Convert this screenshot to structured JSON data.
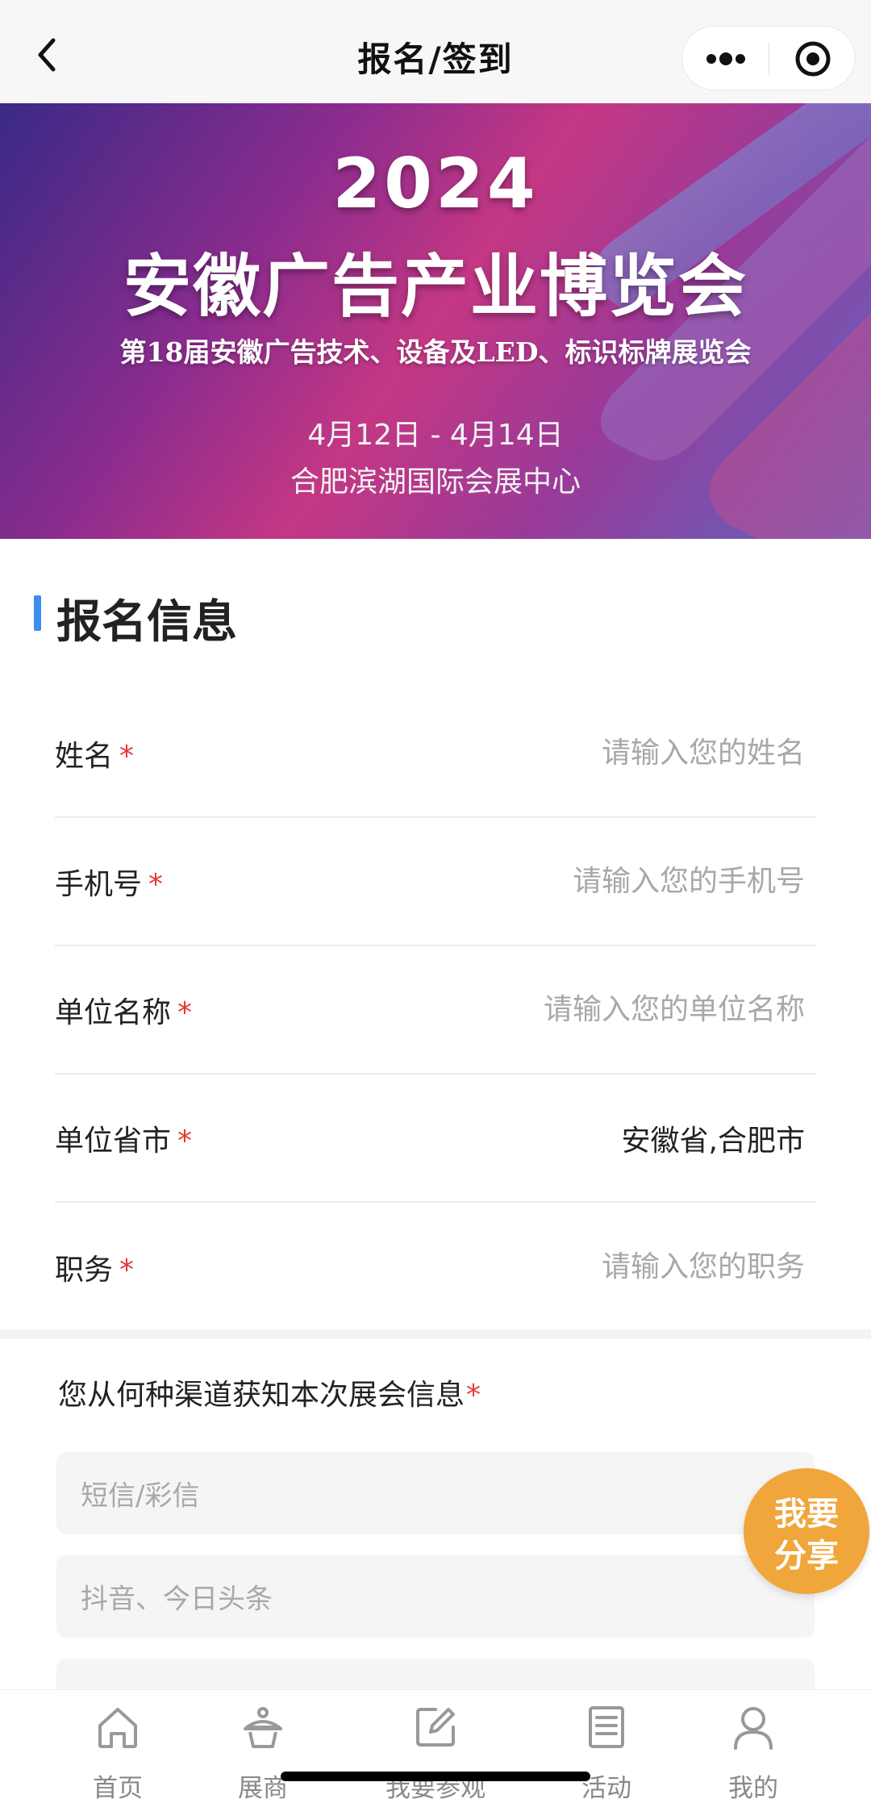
{
  "navbar": {
    "title": "报名/签到",
    "icons": {
      "back": "chevron-left-icon",
      "more": "more-dots-icon",
      "close": "target-circle-icon"
    }
  },
  "banner": {
    "year": "2024",
    "title": "安徽广告产业博览会",
    "subtitle": "第18届安徽广告技术、设备及LED、标识标牌展览会",
    "date": "4月12日 - 4月14日",
    "venue": "合肥滨湖国际会展中心"
  },
  "section": {
    "title": "报名信息",
    "accent_color": "#3d8ef0"
  },
  "form": {
    "fields": [
      {
        "label": "姓名",
        "required_mark": "*",
        "value": "",
        "placeholder": "请输入您的姓名"
      },
      {
        "label": "手机号",
        "required_mark": "*",
        "value": "",
        "placeholder": "请输入您的手机号"
      },
      {
        "label": "单位名称",
        "required_mark": "*",
        "value": "",
        "placeholder": "请输入您的单位名称"
      },
      {
        "label": "单位省市",
        "required_mark": "*",
        "value": "安徽省,合肥市",
        "placeholder": ""
      },
      {
        "label": "职务",
        "required_mark": "*",
        "value": "",
        "placeholder": "请输入您的职务"
      }
    ]
  },
  "channel_question": {
    "label": "您从何种渠道获知本次展会信息",
    "required_mark": "*",
    "options": [
      "短信/彩信",
      "抖音、今日头条"
    ]
  },
  "share_button": {
    "line1": "我要",
    "line2": "分享",
    "color": "#f0a63a"
  },
  "tabbar": {
    "items": [
      {
        "label": "首页",
        "icon": "home-icon"
      },
      {
        "label": "展商",
        "icon": "exhibitor-icon"
      },
      {
        "label": "我要参观",
        "icon": "edit-icon"
      },
      {
        "label": "活动",
        "icon": "document-icon"
      },
      {
        "label": "我的",
        "icon": "user-icon"
      }
    ]
  },
  "colors": {
    "required": "#e53935",
    "placeholder": "#a8a8a8"
  }
}
